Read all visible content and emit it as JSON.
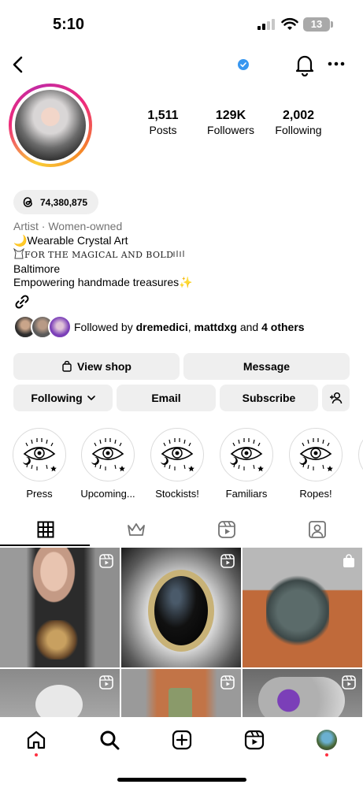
{
  "status": {
    "time": "5:10",
    "battery": "13"
  },
  "profile": {
    "stats": [
      {
        "num": "1,511",
        "label": "Posts"
      },
      {
        "num": "129K",
        "label": "Followers"
      },
      {
        "num": "2,002",
        "label": "Following"
      }
    ],
    "threads_count": "74,380,875",
    "bio": {
      "category": "Artist · Women-owned",
      "line1": "🌙Wearable Crystal Art",
      "line2_fancy": "FOR THE MAGICAL AND BOLD",
      "line3": "Baltimore",
      "line4": "Empowering handmade treasures✨"
    },
    "followed_by": {
      "prefix": "Followed by ",
      "user1": "dremedici",
      "sep": ", ",
      "user2": "mattdxg",
      "mid": " and ",
      "others": "4 others"
    }
  },
  "buttons": {
    "view_shop": "View shop",
    "message": "Message",
    "following": "Following",
    "email": "Email",
    "subscribe": "Subscribe"
  },
  "highlights": [
    {
      "label": "Press"
    },
    {
      "label": "Upcoming..."
    },
    {
      "label": "Stockists!"
    },
    {
      "label": "Familiars"
    },
    {
      "label": "Ropes!"
    }
  ],
  "colors": {
    "accent_dot": "#ff3040",
    "verified": "#3897f0",
    "button_bg": "#efefef"
  }
}
